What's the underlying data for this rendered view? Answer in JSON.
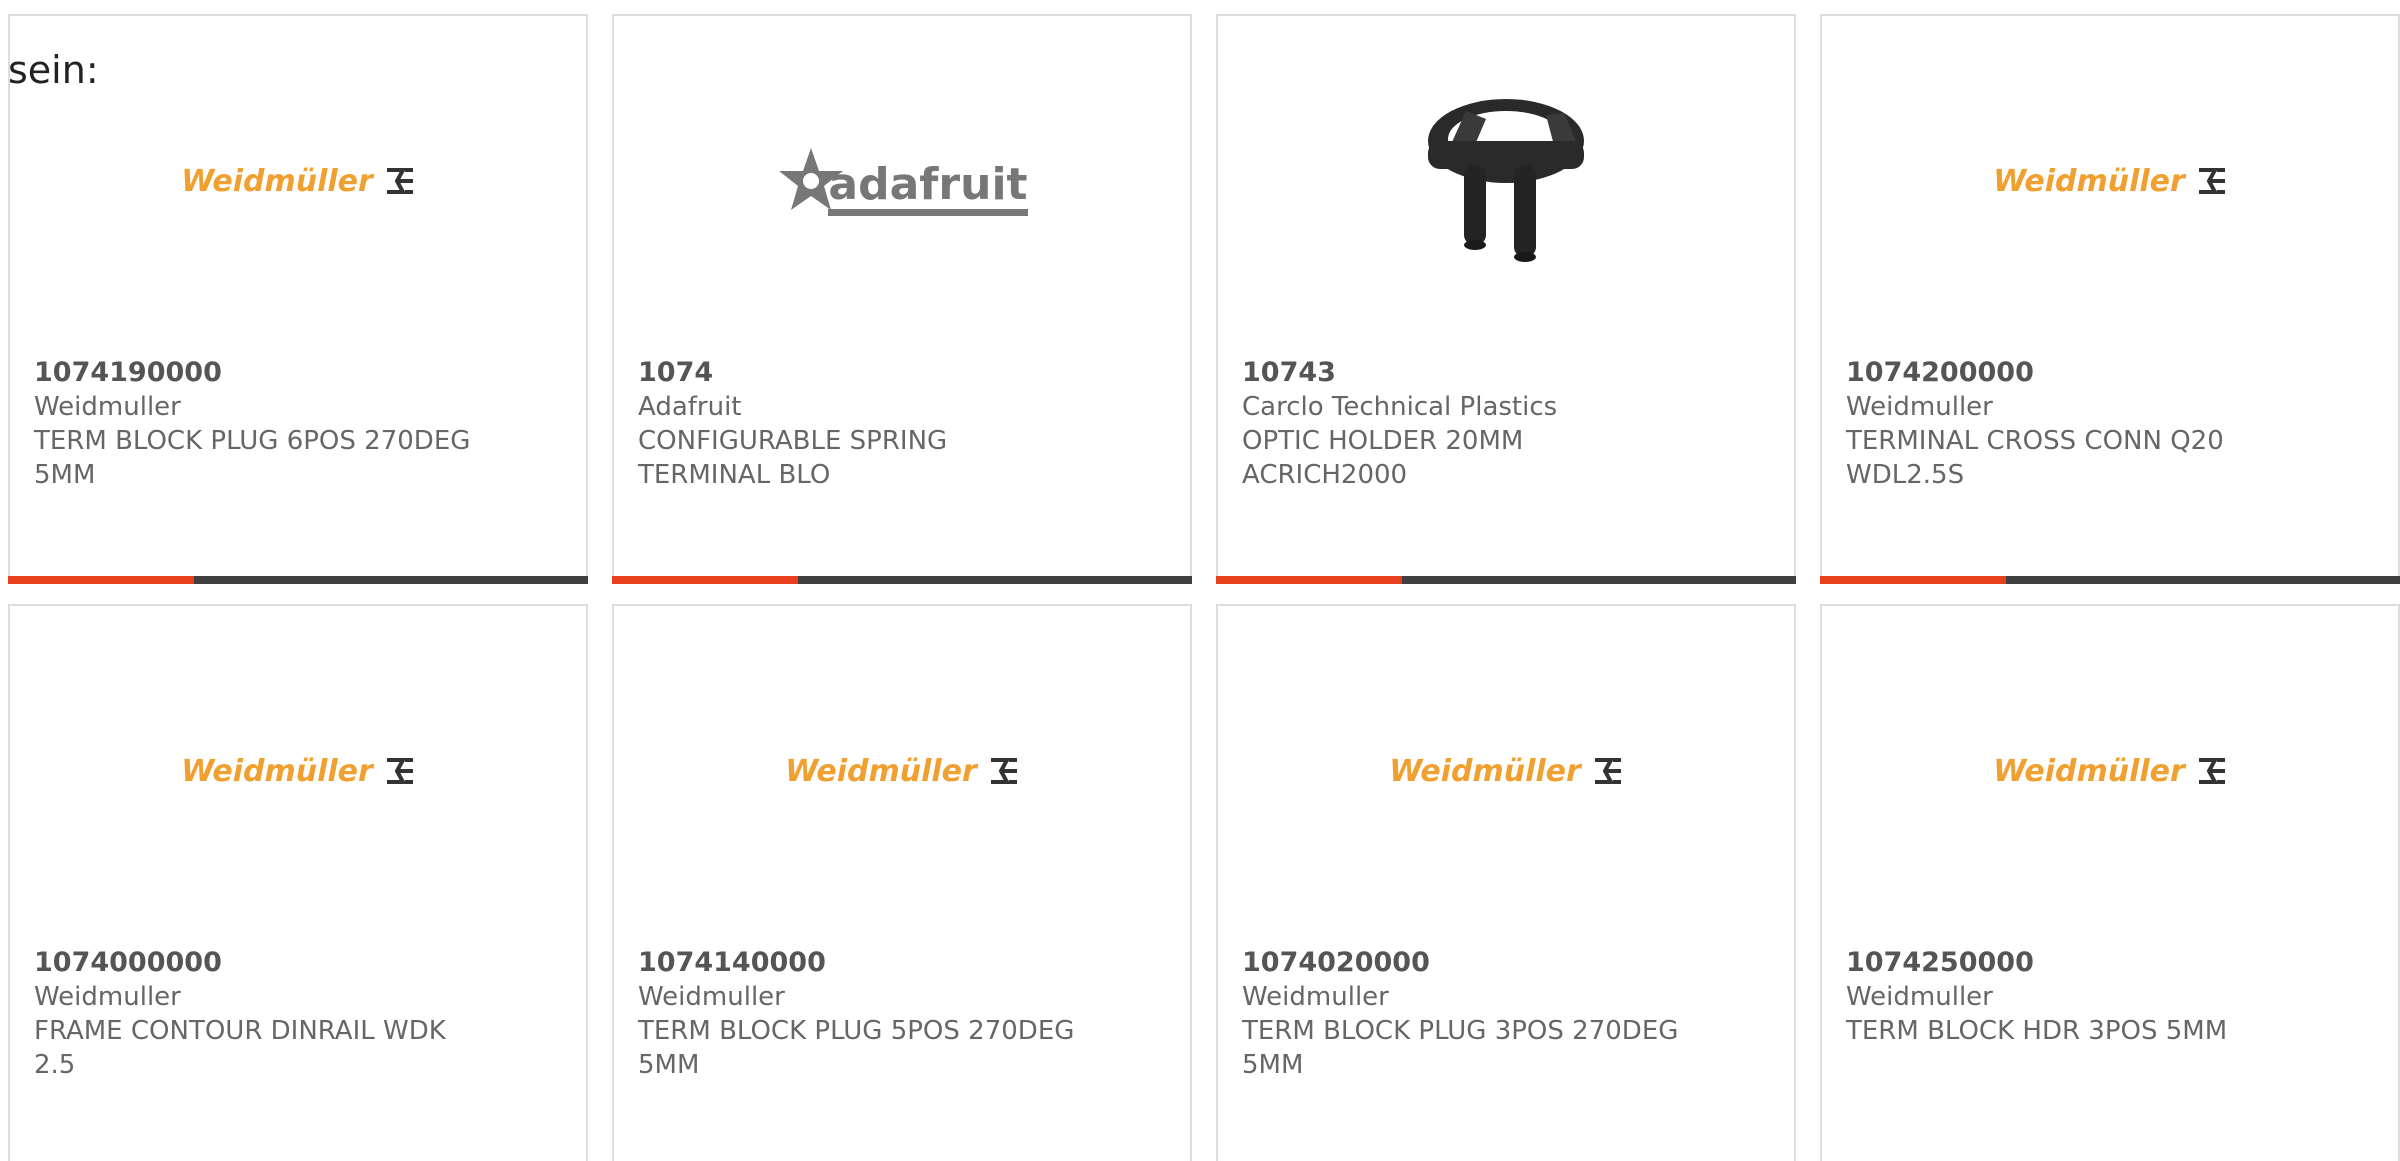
{
  "intro": {
    "text": "sein:"
  },
  "colors": {
    "accent": "#e8401c",
    "bar": "#404040",
    "weidmuller_logo": "#f0a030",
    "adafruit_logo": "#777777"
  },
  "products": [
    {
      "part_number": "1074190000",
      "manufacturer": "Weidmuller",
      "description": "TERM BLOCK PLUG 6POS 270DEG\n5MM",
      "image": "weidmuller-logo",
      "logo_text": "Weidmüller"
    },
    {
      "part_number": "1074",
      "manufacturer": "Adafruit",
      "description": "CONFIGURABLE SPRING\nTERMINAL BLO",
      "image": "adafruit-logo",
      "logo_text": "adafruit"
    },
    {
      "part_number": "10743",
      "manufacturer": "Carclo Technical Plastics",
      "description": "OPTIC HOLDER 20MM\nACRICH2000",
      "image": "optic-holder-photo",
      "logo_text": ""
    },
    {
      "part_number": "1074200000",
      "manufacturer": "Weidmuller",
      "description": "TERMINAL CROSS CONN Q20\nWDL2.5S",
      "image": "weidmuller-logo",
      "logo_text": "Weidmüller"
    },
    {
      "part_number": "1074000000",
      "manufacturer": "Weidmuller",
      "description": "FRAME CONTOUR DINRAIL WDK\n2.5",
      "image": "weidmuller-logo",
      "logo_text": "Weidmüller"
    },
    {
      "part_number": "1074140000",
      "manufacturer": "Weidmuller",
      "description": "TERM BLOCK PLUG 5POS 270DEG\n5MM",
      "image": "weidmuller-logo",
      "logo_text": "Weidmüller"
    },
    {
      "part_number": "1074020000",
      "manufacturer": "Weidmuller",
      "description": "TERM BLOCK PLUG 3POS 270DEG\n5MM",
      "image": "weidmuller-logo",
      "logo_text": "Weidmüller"
    },
    {
      "part_number": "1074250000",
      "manufacturer": "Weidmuller",
      "description": "TERM BLOCK HDR 3POS 5MM",
      "image": "weidmuller-logo",
      "logo_text": "Weidmüller"
    }
  ]
}
